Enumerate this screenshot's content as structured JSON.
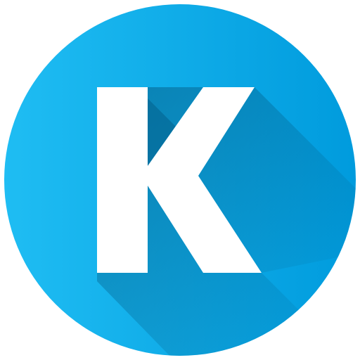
{
  "icon": {
    "letter": "K",
    "icon_name": "letter-k-circle-icon",
    "colors": {
      "circle_light": "#1FBDF3",
      "circle_dark": "#009BDD",
      "border": "#FFFFFF",
      "letter": "#FFFFFF",
      "long_shadow": "#04618C"
    }
  }
}
